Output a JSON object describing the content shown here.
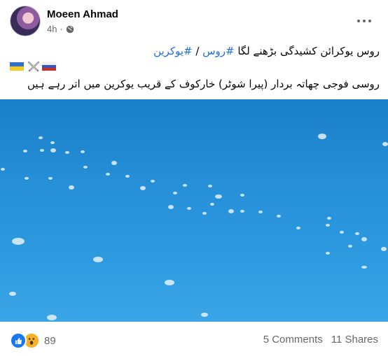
{
  "post": {
    "author": "Moeen Ahmad",
    "time": "4h",
    "line1_text": "روس یوکرائن کشیدگی بڑھنے لگا",
    "hashtag_russia": "#روس",
    "separator": " / ",
    "hashtag_ukraine": "#یوکرین",
    "flags": [
      "ukraine-flag-icon",
      "crossed-swords-icon",
      "russia-flag-icon"
    ],
    "line3_text": "روسی فوجی چھاتہ بردار (پیرا شوٹر) خارکوف کے قریب یوکرین میں اتر رہے ہیں"
  },
  "engagement": {
    "reaction_icons": [
      "like-icon",
      "wow-icon"
    ],
    "reaction_count": "89",
    "comments": "5 Comments",
    "shares": "11 Shares"
  },
  "colors": {
    "hashtag": "#216fdb",
    "secondary_text": "#65676b",
    "like_blue": "#1877f2",
    "wow_yellow": "#f7b125",
    "sky": "#2690d8"
  }
}
